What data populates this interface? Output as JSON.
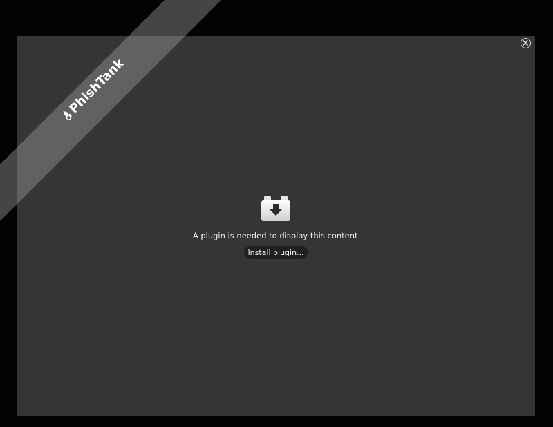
{
  "ribbon": {
    "label": "PhishTank",
    "icon": "phishtank-logo-icon"
  },
  "plugin": {
    "icon": "plugin-download-icon",
    "message": "A plugin is needed to display this content.",
    "install_label": "Install plugin..."
  },
  "close": {
    "icon": "close-icon"
  },
  "colors": {
    "background": "#050206",
    "panel": "#353535",
    "button": "#1f1f1f",
    "text": "#f0f0f0"
  }
}
